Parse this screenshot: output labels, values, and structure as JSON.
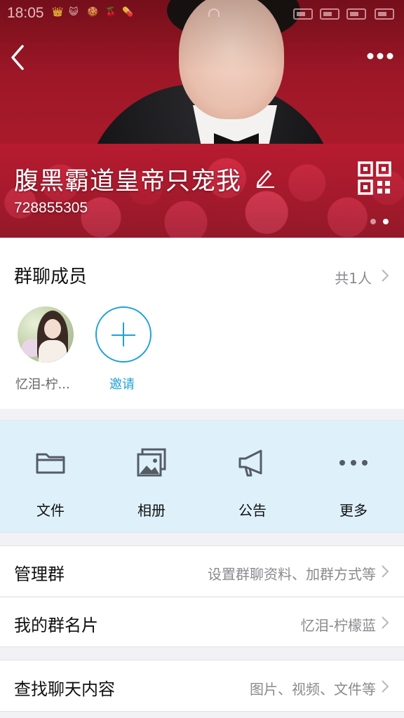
{
  "status_bar": {
    "time": "18:05",
    "notifications": [
      "👑",
      "😺",
      "🍪",
      "🍒",
      "💊"
    ]
  },
  "header": {
    "back_icon": "chevron-left-icon",
    "more_icon": "more-horizontal-icon",
    "group_name": "腹黑霸道皇帝只宠我",
    "edit_icon": "pencil-icon",
    "group_id": "728855305",
    "qr_icon": "qr-code-icon",
    "pager": {
      "count": 2,
      "active": 1
    }
  },
  "members": {
    "title": "群聊成员",
    "count_label": "共1人",
    "list": [
      {
        "name": "忆泪-柠..."
      }
    ],
    "invite_label": "邀请"
  },
  "shortcuts": [
    {
      "label": "文件",
      "icon": "folder-icon"
    },
    {
      "label": "相册",
      "icon": "photo-album-icon"
    },
    {
      "label": "公告",
      "icon": "megaphone-icon"
    },
    {
      "label": "更多",
      "icon": "more-dots-icon"
    }
  ],
  "settings": [
    {
      "title": "管理群",
      "value": "设置群聊资料、加群方式等"
    },
    {
      "title": "我的群名片",
      "value": "忆泪-柠檬蓝"
    },
    {
      "title": "查找聊天内容",
      "value": "图片、视频、文件等"
    }
  ],
  "colors": {
    "accent": "#1fa1d8",
    "banner_red": "#a3192a",
    "shortcut_bg": "#def1fb",
    "secondary_text": "#8a8a8f"
  }
}
